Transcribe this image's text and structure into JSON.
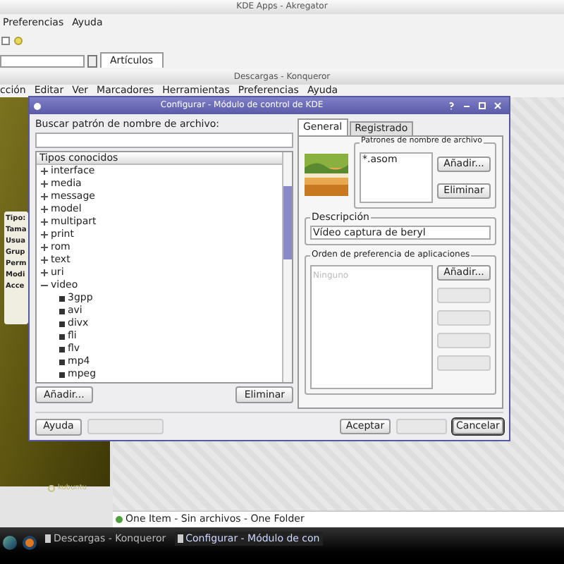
{
  "back_window": {
    "title": "KDE Apps - Akregator",
    "menu": [
      "Preferencias",
      "Ayuda"
    ],
    "tab": "Artículos"
  },
  "konqueror": {
    "title": "Descargas - Konqueror",
    "menu": [
      "cción",
      "Editar",
      "Ver",
      "Marcadores",
      "Herramientas",
      "Preferencias",
      "Ayuda"
    ],
    "sidebar_labels": [
      "Tipo:",
      "Tama",
      "Usua",
      "Grup",
      "Perm",
      "Modi",
      "Acce"
    ],
    "logo": "kubuntu",
    "status": "One Item - Sin archivos - One Folder"
  },
  "dialog": {
    "title": "Configurar - Módulo de control de KDE",
    "search": {
      "label": "Buscar patrón de nombre de archivo:"
    },
    "tree": {
      "header": "Tipos conocidos",
      "items": [
        {
          "label": "interface",
          "expanded": false
        },
        {
          "label": "media",
          "expanded": false
        },
        {
          "label": "message",
          "expanded": false
        },
        {
          "label": "model",
          "expanded": false
        },
        {
          "label": "multipart",
          "expanded": false
        },
        {
          "label": "print",
          "expanded": false
        },
        {
          "label": "rom",
          "expanded": false
        },
        {
          "label": "text",
          "expanded": false
        },
        {
          "label": "uri",
          "expanded": false
        },
        {
          "label": "video",
          "expanded": true,
          "children": [
            {
              "label": "3gpp"
            },
            {
              "label": "avi"
            },
            {
              "label": "divx"
            },
            {
              "label": "fli"
            },
            {
              "label": "flv"
            },
            {
              "label": "mp4"
            },
            {
              "label": "mpeg"
            }
          ]
        }
      ]
    },
    "left_buttons": [
      "Añadir...",
      "Eliminar"
    ],
    "tabs": [
      {
        "label": "General",
        "selected": true
      },
      {
        "label": "Registrado",
        "selected": false
      }
    ],
    "patterns": {
      "title": "Patrones de nombre de archivo",
      "items": [
        "*.asom"
      ],
      "buttons": [
        {
          "label": "Añadir...",
          "disabled": false
        },
        {
          "label": "Eliminar",
          "disabled": false
        }
      ]
    },
    "description": {
      "title": "Descripción",
      "value": "Vídeo captura de beryl"
    },
    "apps": {
      "title": "Orden de preferencia de aplicaciones",
      "placeholder": "Ninguno",
      "buttons": [
        {
          "label": "Añadir...",
          "disabled": false
        },
        {
          "disabled": true
        },
        {
          "disabled": true
        },
        {
          "disabled": true
        },
        {
          "disabled": true
        }
      ]
    },
    "footer_left": [
      {
        "label": "Ayuda",
        "disabled": false
      },
      {
        "disabled": true
      }
    ],
    "footer_right": [
      {
        "label": "Aceptar",
        "disabled": false
      },
      {
        "disabled": true
      },
      {
        "label": "Cancelar",
        "disabled": false
      }
    ]
  },
  "taskbar": {
    "tasks": [
      {
        "label": "Descargas - Konqueror",
        "selected": false
      },
      {
        "label": "Configurar - Módulo de con",
        "selected": true
      }
    ]
  }
}
